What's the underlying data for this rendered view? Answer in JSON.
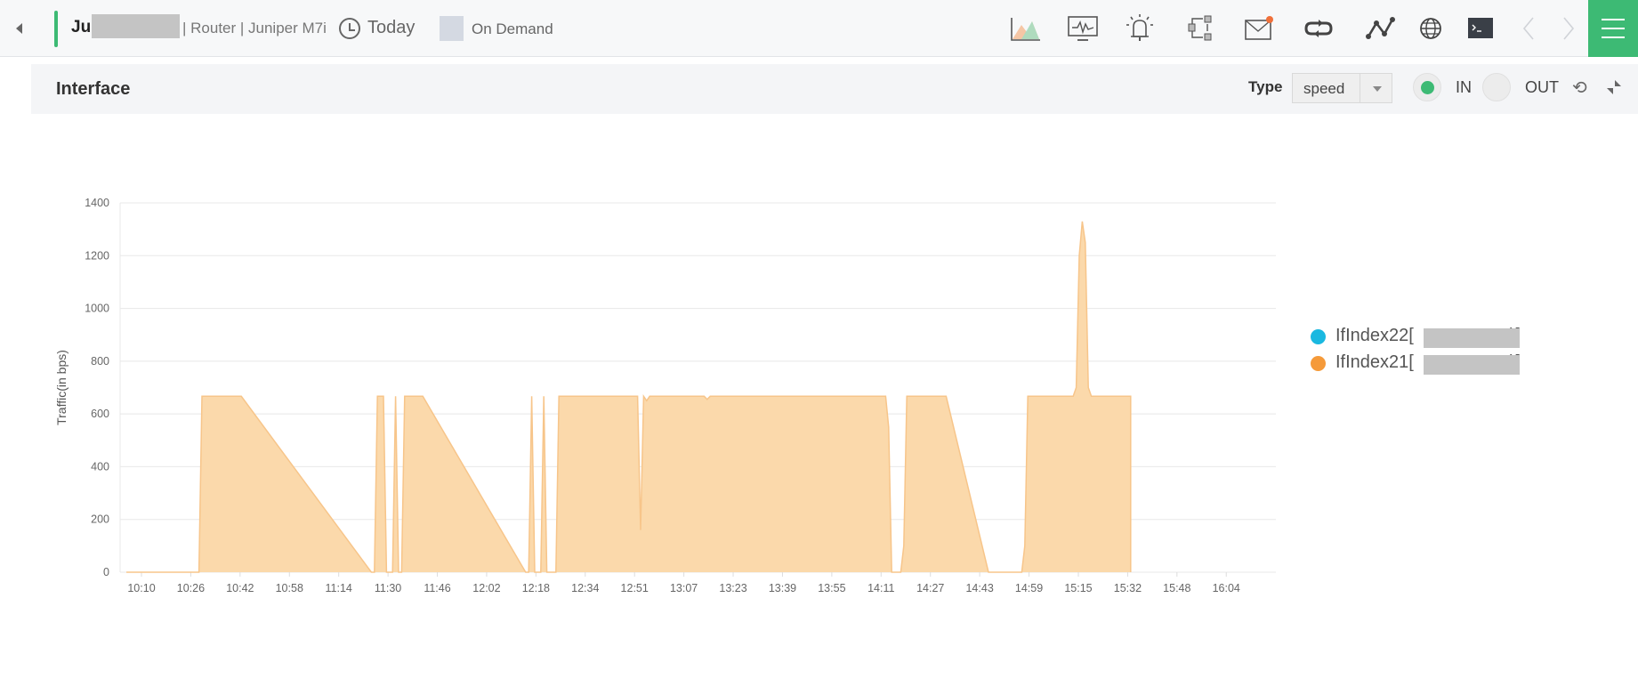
{
  "topbar": {
    "device_name_prefix": "Ju",
    "device_meta": "| Router | Juniper M7i",
    "time_range": "Today",
    "poll_mode": "On Demand",
    "icons": [
      {
        "name": "traffic-graph-icon"
      },
      {
        "name": "monitor-icon"
      },
      {
        "name": "alarm-bell-icon"
      },
      {
        "name": "workflow-icon"
      },
      {
        "name": "mail-notification-icon"
      },
      {
        "name": "sync-loop-icon"
      },
      {
        "name": "path-topology-icon"
      },
      {
        "name": "globe-icon"
      },
      {
        "name": "terminal-icon"
      },
      {
        "name": "prev-arrow-icon"
      },
      {
        "name": "next-arrow-icon"
      }
    ],
    "accent_color": "#3dba74"
  },
  "panel": {
    "title": "Interface",
    "type_label": "Type",
    "type_value": "speed",
    "in_label": "IN",
    "out_label": "OUT",
    "in_selected": true,
    "out_selected": false
  },
  "chart_data": {
    "type": "area",
    "title": "",
    "xlabel": "",
    "ylabel": "Traffic(in bps)",
    "ylim": [
      0,
      1400
    ],
    "yticks": [
      0,
      200,
      400,
      600,
      800,
      1000,
      1200,
      1400
    ],
    "xticks": [
      "10:10",
      "10:26",
      "10:42",
      "10:58",
      "11:14",
      "11:30",
      "11:46",
      "12:02",
      "12:18",
      "12:34",
      "12:51",
      "13:07",
      "13:23",
      "13:39",
      "13:55",
      "14:11",
      "14:27",
      "14:43",
      "14:59",
      "15:15",
      "15:32",
      "15:48",
      "16:04"
    ],
    "x_unit": "minutes since 10:10",
    "xlim": [
      -5,
      350
    ],
    "grid": true,
    "legend_position": "right",
    "series": [
      {
        "name": "IfIndex22[",
        "suffix": ")]",
        "color": "#1ab8e0",
        "points": []
      },
      {
        "name": "IfIndex21[",
        "suffix": ")]",
        "color": "#f59a3a",
        "fill": "#fbd9ab",
        "points": [
          [
            -5,
            0
          ],
          [
            19,
            0
          ],
          [
            20,
            667
          ],
          [
            33,
            667
          ],
          [
            76,
            0
          ],
          [
            77,
            0
          ],
          [
            78,
            667
          ],
          [
            80,
            667
          ],
          [
            81,
            0
          ],
          [
            83,
            0
          ],
          [
            84,
            667
          ],
          [
            85,
            0
          ],
          [
            86,
            0
          ],
          [
            87,
            667
          ],
          [
            93,
            667
          ],
          [
            127,
            0
          ],
          [
            128,
            0
          ],
          [
            129,
            667
          ],
          [
            130,
            0
          ],
          [
            132,
            0
          ],
          [
            133,
            667
          ],
          [
            134,
            0
          ],
          [
            137,
            0
          ],
          [
            138,
            667
          ],
          [
            164,
            667
          ],
          [
            165,
            160
          ],
          [
            166,
            667
          ],
          [
            167,
            650
          ],
          [
            168,
            667
          ],
          [
            186,
            667
          ],
          [
            187,
            655
          ],
          [
            188,
            667
          ],
          [
            246,
            667
          ],
          [
            247,
            550
          ],
          [
            248,
            0
          ],
          [
            251,
            0
          ],
          [
            252,
            100
          ],
          [
            253,
            667
          ],
          [
            266,
            667
          ],
          [
            280,
            0
          ],
          [
            291,
            0
          ],
          [
            292,
            100
          ],
          [
            293,
            667
          ],
          [
            308,
            667
          ],
          [
            309,
            700
          ],
          [
            310,
            1200
          ],
          [
            311,
            1330
          ],
          [
            312,
            1250
          ],
          [
            313,
            700
          ],
          [
            314,
            667
          ],
          [
            327,
            667
          ],
          [
            327,
            0
          ]
        ]
      }
    ]
  }
}
